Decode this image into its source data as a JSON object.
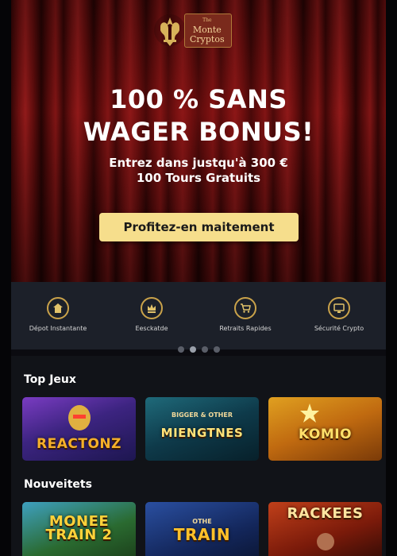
{
  "brand": {
    "name_small": "The",
    "name_line1": "Monte",
    "name_line2": "Cryptos"
  },
  "hero": {
    "headline_line1": "100 % SANS",
    "headline_line2": "WAGER BONUS!",
    "sub_line1": "Entrez dans justqu'à 300 €",
    "sub_line2": "100 Tours Gratuits",
    "cta_label": "Profitez-en maitement"
  },
  "features": [
    {
      "label": "Dépot Instantante",
      "icon": "home-icon"
    },
    {
      "label": "Eesckatde",
      "icon": "crown-icon"
    },
    {
      "label": "Retraits Rapides",
      "icon": "cart-icon"
    },
    {
      "label": "Sécurité Crypto",
      "icon": "monitor-icon"
    }
  ],
  "carousel": {
    "pages": 4,
    "active": 1
  },
  "sections": {
    "top_games_title": "Top Jeux",
    "new_games_title": "Nouveitets"
  },
  "top_games": [
    {
      "title": "REACTONZ",
      "subtitle": ""
    },
    {
      "title": "MIENGTNES",
      "subtitle": "BIGGER & OTHER"
    },
    {
      "title": "KOMIO",
      "subtitle": ""
    }
  ],
  "new_games": [
    {
      "title": "MONEE TRAIN 2",
      "subtitle": ""
    },
    {
      "title": "TRAIN",
      "subtitle": "OTHE"
    },
    {
      "title": "RACKEES",
      "subtitle": ""
    }
  ],
  "colors": {
    "cta_bg": "#f6de8c",
    "feature_ring": "#c9a24a",
    "features_bg": "#1c2029",
    "games_bg": "#111318"
  }
}
